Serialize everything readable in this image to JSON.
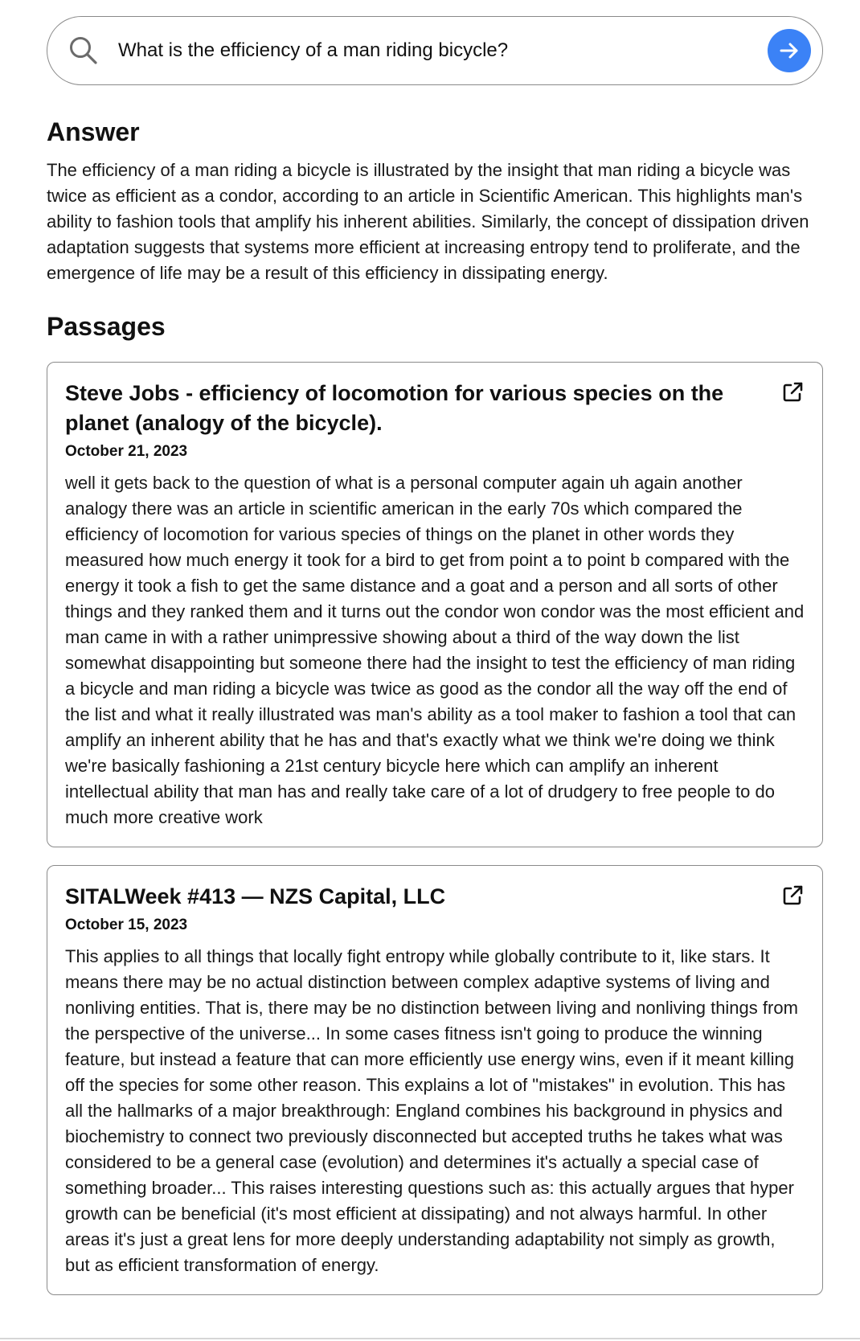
{
  "search": {
    "query": "What is the efficiency of a man riding bicycle?",
    "search_icon": "search-icon",
    "submit_icon": "arrow-right-icon",
    "submit_color": "#3b82f6"
  },
  "answer": {
    "heading": "Answer",
    "text": "The efficiency of a man riding a bicycle is illustrated by the insight that man riding a bicycle was twice as efficient as a condor, according to an article in Scientific American. This highlights man's ability to fashion tools that amplify his inherent abilities. Similarly, the concept of dissipation driven adaptation suggests that systems more efficient at increasing entropy tend to proliferate, and the emergence of life may be a result of this efficiency in dissipating energy."
  },
  "passages": {
    "heading": "Passages",
    "items": [
      {
        "title": "Steve Jobs - efficiency of locomotion for various species on the planet (analogy of the bicycle).",
        "date": "October 21, 2023",
        "text": "well it gets back to the question of what is a personal computer again uh again another analogy there was an article in scientific american in the early 70s which compared the efficiency of locomotion for various species of things on the planet in other words they measured how much energy it took for a bird to get from point a to point b compared with the energy it took a fish to get the same distance and a goat and a person and all sorts of other things and they ranked them and it turns out the condor won condor was the most efficient and man came in with a rather unimpressive showing about a third of the way down the list somewhat disappointing but someone there had the insight to test the efficiency of man riding a bicycle and man riding a bicycle was twice as good as the condor all the way off the end of the list and what it really illustrated was man's ability as a tool maker to fashion a tool that can amplify an inherent ability that he has and that's exactly what we think we're doing we think we're basically fashioning a 21st century bicycle here which can amplify an inherent intellectual ability that man has and really take care of a lot of drudgery to free people to do much more creative work",
        "link_icon": "external-link-icon"
      },
      {
        "title": "SITALWeek #413 — NZS Capital, LLC",
        "date": "October 15, 2023",
        "text": "This applies to all things that locally fight entropy while globally contribute to it, like stars. It means there may be no actual distinction between complex adaptive systems of living and nonliving entities. That is, there may be no distinction between living and nonliving things from the perspective of the universe... In some cases fitness isn't going to produce the winning feature, but instead a feature that can more efficiently use energy wins, even if it meant killing off the species for some other reason. This explains a lot of \"mistakes\" in evolution. This has all the hallmarks of a major breakthrough: England combines his background in physics and biochemistry to connect two previously disconnected but accepted truths he takes what was considered to be a general case (evolution) and determines it's actually a special case of something broader... This raises interesting questions such as: this actually argues that hyper growth can be beneficial (it's most efficient at dissipating) and not always harmful. In other areas it's just a great lens for more deeply understanding adaptability not simply as growth, but as efficient transformation of energy.",
        "link_icon": "external-link-icon"
      }
    ]
  }
}
